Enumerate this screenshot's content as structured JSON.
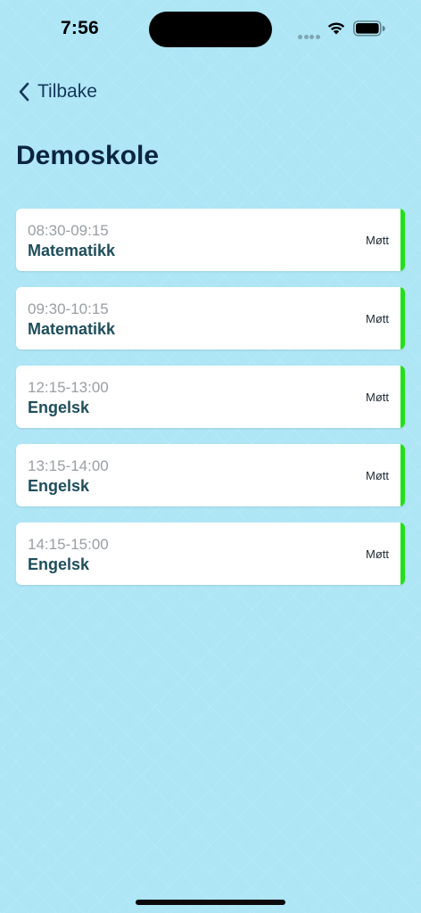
{
  "status_bar": {
    "time": "7:56",
    "icons": [
      "signal-icon",
      "wifi-icon",
      "battery-icon"
    ]
  },
  "nav": {
    "back_label": "Tilbake",
    "back_icon": "chevron-left-icon"
  },
  "page": {
    "title": "Demoskole"
  },
  "lessons": [
    {
      "time": "08:30-09:15",
      "subject": "Matematikk",
      "status": "Møtt"
    },
    {
      "time": "09:30-10:15",
      "subject": "Matematikk",
      "status": "Møtt"
    },
    {
      "time": "12:15-13:00",
      "subject": "Engelsk",
      "status": "Møtt"
    },
    {
      "time": "13:15-14:00",
      "subject": "Engelsk",
      "status": "Møtt"
    },
    {
      "time": "14:15-15:00",
      "subject": "Engelsk",
      "status": "Møtt"
    }
  ],
  "colors": {
    "background": "#aee6f6",
    "title": "#0a2540",
    "subject": "#1f4e5c",
    "time": "#9a9fa4",
    "status_present": "#22e01a"
  }
}
